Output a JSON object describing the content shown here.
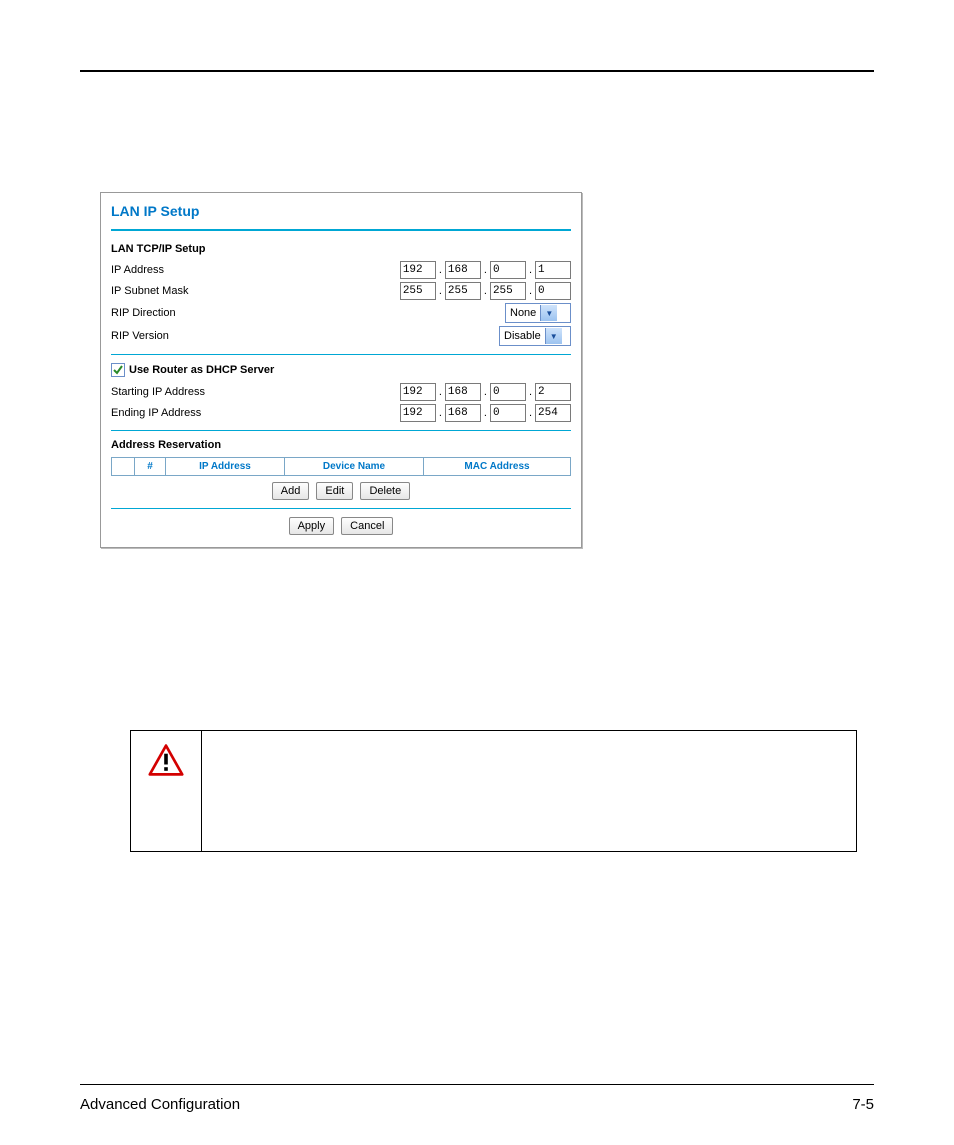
{
  "panel": {
    "title": "LAN IP Setup",
    "sections": {
      "tcp_ip": {
        "title": "LAN TCP/IP Setup",
        "ip_address_label": "IP Address",
        "ip_address": [
          "192",
          "168",
          "0",
          "1"
        ],
        "subnet_label": "IP Subnet Mask",
        "subnet": [
          "255",
          "255",
          "255",
          "0"
        ],
        "rip_direction_label": "RIP Direction",
        "rip_direction_value": "None",
        "rip_version_label": "RIP Version",
        "rip_version_value": "Disable"
      },
      "dhcp": {
        "checkbox_label": "Use Router as DHCP Server",
        "checked": true,
        "start_label": "Starting IP Address",
        "start_ip": [
          "192",
          "168",
          "0",
          "2"
        ],
        "end_label": "Ending IP Address",
        "end_ip": [
          "192",
          "168",
          "0",
          "254"
        ]
      },
      "reservation": {
        "title": "Address Reservation",
        "headers": {
          "num": "#",
          "ip": "IP Address",
          "device": "Device Name",
          "mac": "MAC Address"
        },
        "buttons": {
          "add": "Add",
          "edit": "Edit",
          "delete": "Delete"
        }
      }
    },
    "footer_buttons": {
      "apply": "Apply",
      "cancel": "Cancel"
    }
  },
  "page_footer": {
    "section": "Advanced Configuration",
    "page_num": "7-5"
  }
}
